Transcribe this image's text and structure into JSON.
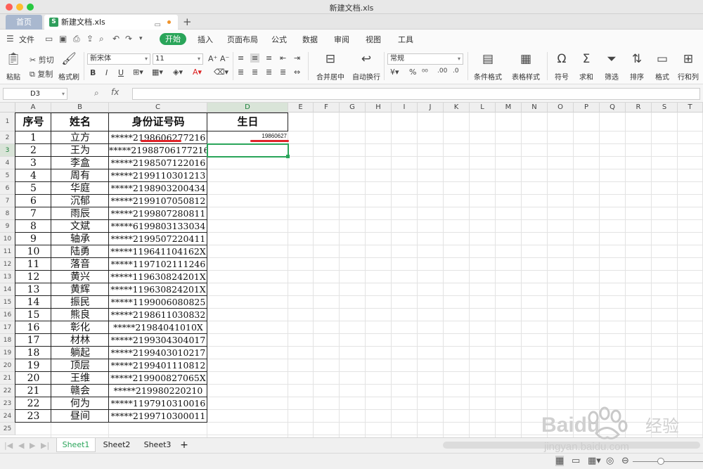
{
  "window": {
    "title": "新建文档.xls"
  },
  "tabs": {
    "home": "首页",
    "doc": "新建文档.xls"
  },
  "menu": {
    "file": "文件",
    "items": [
      "开始",
      "插入",
      "页面布局",
      "公式",
      "数据",
      "审阅",
      "视图",
      "工具"
    ]
  },
  "ribbon": {
    "paste": "粘贴",
    "cut": "剪切",
    "copy": "复制",
    "format_painter": "格式刷",
    "font_name": "新宋体",
    "font_size": "11",
    "merge_center": "合并居中",
    "wrap_text": "自动换行",
    "number_format": "常规",
    "cond_format": "条件格式",
    "table_style": "表格样式",
    "symbol": "符号",
    "sum": "求和",
    "filter": "筛选",
    "sort": "排序",
    "format": "格式",
    "row_col": "行和列"
  },
  "formula_bar": {
    "name_box": "D3",
    "fx": "fx",
    "content": ""
  },
  "columns": [
    "A",
    "B",
    "C",
    "D",
    "E",
    "F",
    "G",
    "H",
    "I",
    "J",
    "K",
    "L",
    "M",
    "N",
    "O",
    "P",
    "Q",
    "R",
    "S",
    "T"
  ],
  "active_cell": {
    "column": "D",
    "row": 3
  },
  "table": {
    "headers": [
      "序号",
      "姓名",
      "身份证号码",
      "生日"
    ],
    "rows": [
      [
        "1",
        "立方",
        "*****2198606277216",
        "19860627"
      ],
      [
        "2",
        "王为",
        "*****21988706177216",
        ""
      ],
      [
        "3",
        "李盒",
        "*****2198507122016",
        ""
      ],
      [
        "4",
        "周有",
        "*****2199110301213",
        ""
      ],
      [
        "5",
        "华庭",
        "*****2198903200434",
        ""
      ],
      [
        "6",
        "沉郁",
        "*****2199107050812",
        ""
      ],
      [
        "7",
        "雨辰",
        "*****2199807280811",
        ""
      ],
      [
        "8",
        "文斌",
        "*****6199803133034",
        ""
      ],
      [
        "9",
        "轴承",
        "*****2199507220411",
        ""
      ],
      [
        "10",
        "陆勇",
        "*****119641104162X",
        ""
      ],
      [
        "11",
        "落音",
        "*****1197102111246",
        ""
      ],
      [
        "12",
        "黄兴",
        "*****119630824201X",
        ""
      ],
      [
        "13",
        "黄辉",
        "*****119630824201X",
        ""
      ],
      [
        "14",
        "振民",
        "*****1199006080825",
        ""
      ],
      [
        "15",
        "熊良",
        "*****2198611030832",
        ""
      ],
      [
        "16",
        "彰化",
        "*****21984041010X",
        ""
      ],
      [
        "17",
        "材林",
        "*****2199304304017",
        ""
      ],
      [
        "18",
        "躺起",
        "*****2199403010217",
        ""
      ],
      [
        "19",
        "顶层",
        "*****2199401110812",
        ""
      ],
      [
        "20",
        "王维",
        "*****219900827065X",
        ""
      ],
      [
        "21",
        "赣会",
        "*****219980220210",
        ""
      ],
      [
        "22",
        "何为",
        "*****1197910310016",
        ""
      ],
      [
        "23",
        "昼间",
        "*****2199710300011",
        ""
      ]
    ]
  },
  "sheets": [
    "Sheet1",
    "Sheet2",
    "Sheet3"
  ],
  "active_sheet": "Sheet1",
  "watermark": {
    "brand": "Baidu",
    "brand_cn": "经验",
    "url": "jingyan.baidu.com"
  },
  "colors": {
    "accent": "#2aa55a",
    "underline": "#e0242a",
    "home_tab": "#a9b8cf"
  }
}
